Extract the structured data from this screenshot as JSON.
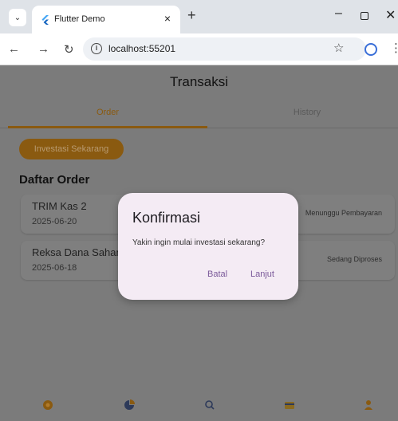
{
  "browser": {
    "tab_title": "Flutter Demo",
    "tab_close": "×",
    "new_tab": "+",
    "url": "localhost:55201",
    "icons": [
      "chevron-down-icon",
      "flutter-icon",
      "back-icon",
      "forward-icon",
      "reload-icon",
      "info-icon",
      "star-icon",
      "profile-icon",
      "kebab-icon",
      "minimize-icon",
      "maximize-icon",
      "close-icon"
    ]
  },
  "app": {
    "title": "Transaksi",
    "tabs": [
      {
        "label": "Order"
      },
      {
        "label": "History"
      }
    ],
    "invest_button": "Investasi Sekarang",
    "section_title": "Daftar Order",
    "orders": [
      {
        "name": "TRIM Kas 2",
        "date": "2025-06-20",
        "status": "Menunggu Pembayaran"
      },
      {
        "name": "Reksa Dana Saham",
        "date": "2025-06-18",
        "status": "Sedang Diproses"
      }
    ],
    "bottom_nav": [
      "home-icon",
      "portfolio-icon",
      "search-icon",
      "wallet-icon",
      "profile-icon"
    ],
    "accent_color": "#8a5a10"
  },
  "dialog": {
    "title": "Konfirmasi",
    "message": "Yakin ingin mulai investasi sekarang?",
    "cancel": "Batal",
    "confirm": "Lanjut"
  }
}
